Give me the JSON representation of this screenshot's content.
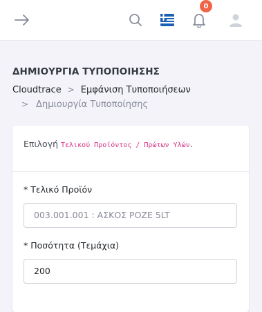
{
  "topbar": {
    "notification_count": "0",
    "language_flag": "greek-flag-icon",
    "colors": {
      "badge": "#f06548",
      "icons": "#878a99"
    }
  },
  "page": {
    "title": "ΔΗΜΙΟΥΡΓΙΑ ΤΥΠΟΠΟΙΗΣΗΣ"
  },
  "breadcrumb": {
    "items": [
      "Cloudtrace",
      "Εμφάνιση Τυποποιήσεων",
      "Δημιουργία Τυποποίησης"
    ]
  },
  "card": {
    "header": {
      "prefix": "Επιλογή ",
      "code": "Τελικού Προϊόντος / Πρώτων Υλών",
      "suffix": "."
    }
  },
  "form": {
    "product": {
      "label": "* Τελικό Προϊόν",
      "placeholder": "003.001.001 : ΑΣΚΟΣ ΡΟΖΕ 5LT"
    },
    "quantity": {
      "label": "* Ποσότητα (Τεμάχια)",
      "value": "200"
    }
  }
}
